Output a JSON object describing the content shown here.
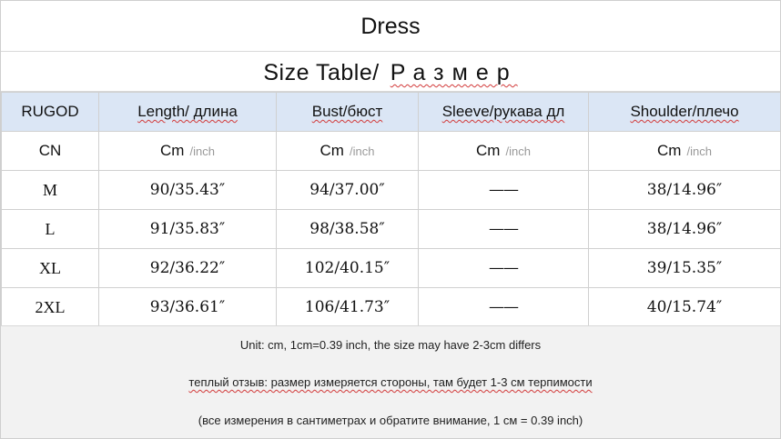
{
  "title": "Dress",
  "subtitle": {
    "en": "Size Table/",
    "ru": "Размер"
  },
  "table": {
    "headers": [
      "RUGOD",
      "Length/ длина",
      "Bust/бюст",
      "Sleeve/рукава дл",
      "Shoulder/плечо"
    ],
    "units_row": {
      "label": "CN",
      "cells": [
        {
          "unit": "Cm",
          "alt": "/inch"
        },
        {
          "unit": "Cm",
          "alt": "/inch"
        },
        {
          "unit": "Cm",
          "alt": "/inch"
        },
        {
          "unit": "Cm",
          "alt": "/inch"
        }
      ]
    },
    "rows": [
      [
        "M",
        "90/35.43″",
        "94/37.00″",
        "——",
        "38/14.96″"
      ],
      [
        "L",
        "91/35.83″",
        "98/38.58″",
        "——",
        "38/14.96″"
      ],
      [
        "XL",
        "92/36.22″",
        "102/40.15″",
        "——",
        "39/15.35″"
      ],
      [
        "2XL",
        "93/36.61″",
        "106/41.73″",
        "——",
        "40/15.74″"
      ]
    ]
  },
  "notes": [
    "Unit: cm, 1cm=0.39 inch, the size may have 2-3cm differs",
    "теплый отзыв: размер измеряется стороны, там будет 1-3 см терпимости",
    "(все измерения в сантиметрах и обратите внимание, 1 см = 0.39 inch)"
  ]
}
